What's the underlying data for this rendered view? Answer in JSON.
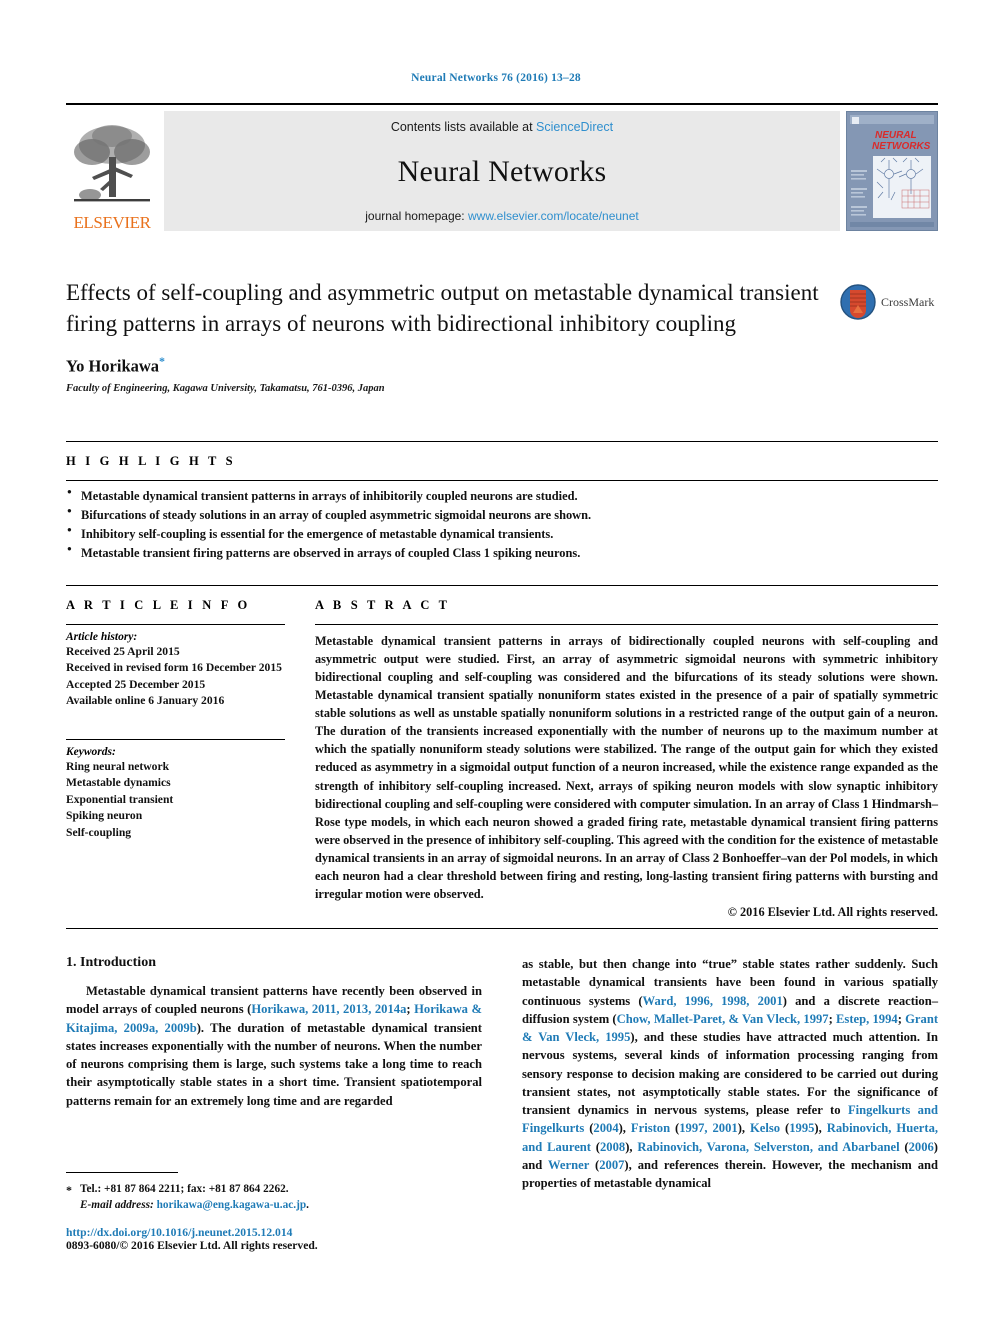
{
  "running_head": "Neural Networks 76 (2016) 13–28",
  "masthead": {
    "publisher_name": "ELSEVIER",
    "contents_prefix": "Contents lists available at ",
    "sciencedirect": "ScienceDirect",
    "journal_title": "Neural Networks",
    "homepage_prefix": "journal homepage: ",
    "homepage_url": "www.elsevier.com/locate/neunet",
    "cover_title_line1": "NEURAL",
    "cover_title_line2": "NETWORKS",
    "accent_blue": "#2f8fce",
    "elsevier_orange": "#e9711c"
  },
  "article": {
    "title": "Effects of self-coupling and asymmetric output on metastable dynamical transient firing patterns in arrays of neurons with bidirectional inhibitory coupling",
    "author": "Yo Horikawa",
    "author_marker": "*",
    "affiliation": "Faculty of Engineering, Kagawa University, Takamatsu, 761-0396, Japan",
    "crossmark_label": "CrossMark"
  },
  "highlights": {
    "heading": "H I G H L I G H T S",
    "items": [
      "Metastable dynamical transient patterns in arrays of inhibitorily coupled neurons are studied.",
      "Bifurcations of steady solutions in an array of coupled asymmetric sigmoidal neurons are shown.",
      "Inhibitory self-coupling is essential for the emergence of metastable dynamical transients.",
      "Metastable transient firing patterns are observed in arrays of coupled Class 1 spiking neurons."
    ]
  },
  "article_info": {
    "heading": "A R T I C L E    I N F O",
    "history_label": "Article history:",
    "history": [
      "Received 25 April 2015",
      "Received in revised form 16 December 2015",
      "Accepted 25 December 2015",
      "Available online 6 January 2016"
    ],
    "keywords_label": "Keywords:",
    "keywords": [
      "Ring neural network",
      "Metastable dynamics",
      "Exponential transient",
      "Spiking neuron",
      "Self-coupling"
    ]
  },
  "abstract": {
    "heading": "A B S T R A C T",
    "text": "Metastable dynamical transient patterns in arrays of bidirectionally coupled neurons with self-coupling and asymmetric output were studied. First, an array of asymmetric sigmoidal neurons with symmetric inhibitory bidirectional coupling and self-coupling was considered and the bifurcations of its steady solutions were shown. Metastable dynamical transient spatially nonuniform states existed in the presence of a pair of spatially symmetric stable solutions as well as unstable spatially nonuniform solutions in a restricted range of the output gain of a neuron. The duration of the transients increased exponentially with the number of neurons up to the maximum number at which the spatially nonuniform steady solutions were stabilized. The range of the output gain for which they existed reduced as asymmetry in a sigmoidal output function of a neuron increased, while the existence range expanded as the strength of inhibitory self-coupling increased. Next, arrays of spiking neuron models with slow synaptic inhibitory bidirectional coupling and self-coupling were considered with computer simulation. In an array of Class 1 Hindmarsh–Rose type models, in which each neuron showed a graded firing rate, metastable dynamical transient firing patterns were observed in the presence of inhibitory self-coupling. This agreed with the condition for the existence of metastable dynamical transients in an array of sigmoidal neurons. In an array of Class 2 Bonhoeffer–van der Pol models, in which each neuron had a clear threshold between firing and resting, long-lasting transient firing patterns with bursting and irregular motion were observed.",
    "copyright": "© 2016 Elsevier Ltd. All rights reserved."
  },
  "body": {
    "section_number_title": "1. Introduction",
    "left_paragraph_segments": [
      {
        "t": "Metastable dynamical transient patterns have recently been observed in model arrays of coupled neurons (",
        "cite": false
      },
      {
        "t": "Horikawa, 2011, 2013, 2014a",
        "cite": true
      },
      {
        "t": "; ",
        "cite": false
      },
      {
        "t": "Horikawa & Kitajima, 2009a, 2009b",
        "cite": true
      },
      {
        "t": "). The duration of metastable dynamical transient states increases exponentially with the number of neurons. When the number of neurons comprising them is large, such systems take a long time to reach their asymptotically stable states in a short time. Transient spatiotemporal patterns remain for an extremely long time and are regarded",
        "cite": false
      }
    ],
    "right_paragraph_segments": [
      {
        "t": "as stable, but then change into “true” stable states rather suddenly. Such metastable dynamical transients have been found in various spatially continuous systems (",
        "cite": false
      },
      {
        "t": "Ward, 1996, 1998, 2001",
        "cite": true
      },
      {
        "t": ") and a discrete reaction–diffusion system (",
        "cite": false
      },
      {
        "t": "Chow, Mallet-Paret, & Van Vleck, 1997",
        "cite": true
      },
      {
        "t": "; ",
        "cite": false
      },
      {
        "t": "Estep, 1994",
        "cite": true
      },
      {
        "t": "; ",
        "cite": false
      },
      {
        "t": "Grant & Van Vleck, 1995",
        "cite": true
      },
      {
        "t": "), and these studies have attracted much attention. In nervous systems, several kinds of information processing ranging from sensory response to decision making are considered to be carried out during transient states, not asymptotically stable states. For the significance of transient dynamics in nervous systems, please refer to ",
        "cite": false
      },
      {
        "t": "Fingelkurts and Fingelkurts",
        "cite": true
      },
      {
        "t": " (",
        "cite": false
      },
      {
        "t": "2004",
        "cite": true
      },
      {
        "t": "), ",
        "cite": false
      },
      {
        "t": "Friston",
        "cite": true
      },
      {
        "t": " (",
        "cite": false
      },
      {
        "t": "1997, 2001",
        "cite": true
      },
      {
        "t": "), ",
        "cite": false
      },
      {
        "t": "Kelso",
        "cite": true
      },
      {
        "t": " (",
        "cite": false
      },
      {
        "t": "1995",
        "cite": true
      },
      {
        "t": "), ",
        "cite": false
      },
      {
        "t": "Rabinovich, Huerta, and Laurent",
        "cite": true
      },
      {
        "t": " (",
        "cite": false
      },
      {
        "t": "2008",
        "cite": true
      },
      {
        "t": "), ",
        "cite": false
      },
      {
        "t": "Rabinovich, Varona, Selverston, and Abarbanel",
        "cite": true
      },
      {
        "t": " (",
        "cite": false
      },
      {
        "t": "2006",
        "cite": true
      },
      {
        "t": ") and ",
        "cite": false
      },
      {
        "t": "Werner",
        "cite": true
      },
      {
        "t": " (",
        "cite": false
      },
      {
        "t": "2007",
        "cite": true
      },
      {
        "t": "), and references therein. However, the mechanism and properties of metastable dynamical",
        "cite": false
      }
    ]
  },
  "footnote": {
    "marker": "*",
    "tel_fax": "Tel.: +81 87 864 2211; fax: +81 87 864 2262.",
    "email_label": "E-mail address:",
    "email": "horikawa@eng.kagawa-u.ac.jp",
    "email_suffix": ".",
    "doi": "http://dx.doi.org/10.1016/j.neunet.2015.12.014",
    "issn_line": "0893-6080/© 2016 Elsevier Ltd. All rights reserved."
  }
}
